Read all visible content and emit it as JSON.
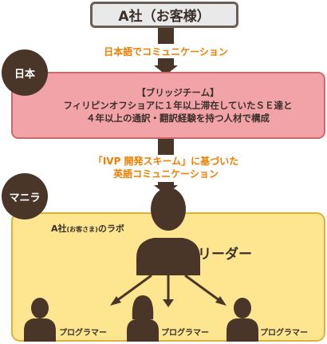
{
  "client": {
    "label": "A社（お客様）"
  },
  "japan_link": {
    "caption": "日本語でコミュニケーション"
  },
  "japan": {
    "region_label": "日本",
    "lines": [
      "【ブリッジチーム】",
      "フィリピンオフショアに１年以上滞在していたＳＥ達と",
      "４年以上の通訳・翻訳経験を持つ人材で構成"
    ]
  },
  "manila_link": {
    "caption_line1": "「IVP 開発スキーム」に基づいた",
    "caption_line2": "英語コミュニケーション"
  },
  "manila": {
    "region_label": "マニラ",
    "lab_label_prefix": "A社",
    "lab_label_small": "(お客さま)",
    "lab_label_suffix": "のラボ",
    "leader_label": "リーダー",
    "programmers": [
      "プログラマー",
      "プログラマー",
      "プログラマー"
    ]
  },
  "colors": {
    "dark_brown": "#4a3628",
    "accent_orange": "#ef7d00",
    "japan_fill": "#f2a3a7",
    "manila_fill": "#fde68f",
    "client_fill": "#e9e9e9"
  }
}
